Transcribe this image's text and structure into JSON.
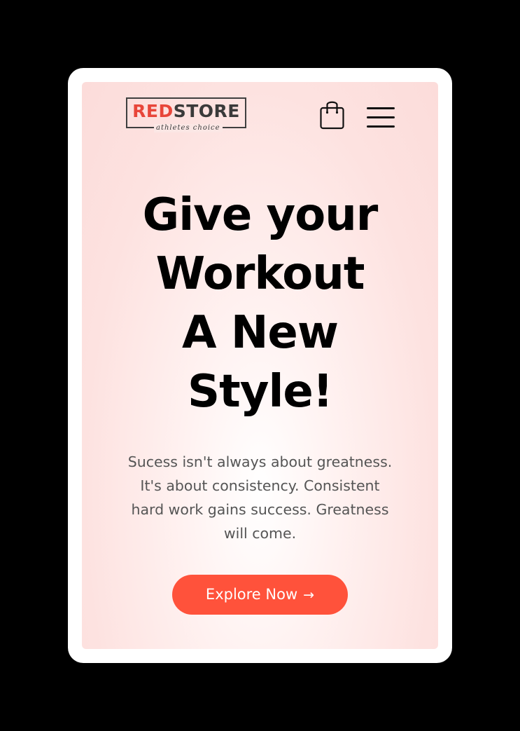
{
  "header": {
    "logo_red": "RED",
    "logo_dark": "STORE",
    "logo_tagline": "athletes choice",
    "cart_icon": "shopping-bag-icon",
    "menu_icon": "hamburger-menu-icon"
  },
  "hero": {
    "title_lines": [
      "Give your",
      "Workout",
      "A New",
      "Style!"
    ],
    "description_lines": [
      "Sucess isn't always about greatness.",
      "It's about consistency. Consistent",
      "hard work gains success. Greatness",
      "will come."
    ],
    "cta_label": "Explore Now",
    "cta_arrow": "→"
  },
  "colors": {
    "accent": "#ff523b",
    "logo_red": "#e8463a",
    "background_tint": "#fcdcda",
    "frame": "#ffffff",
    "outer_background": "#000000"
  }
}
